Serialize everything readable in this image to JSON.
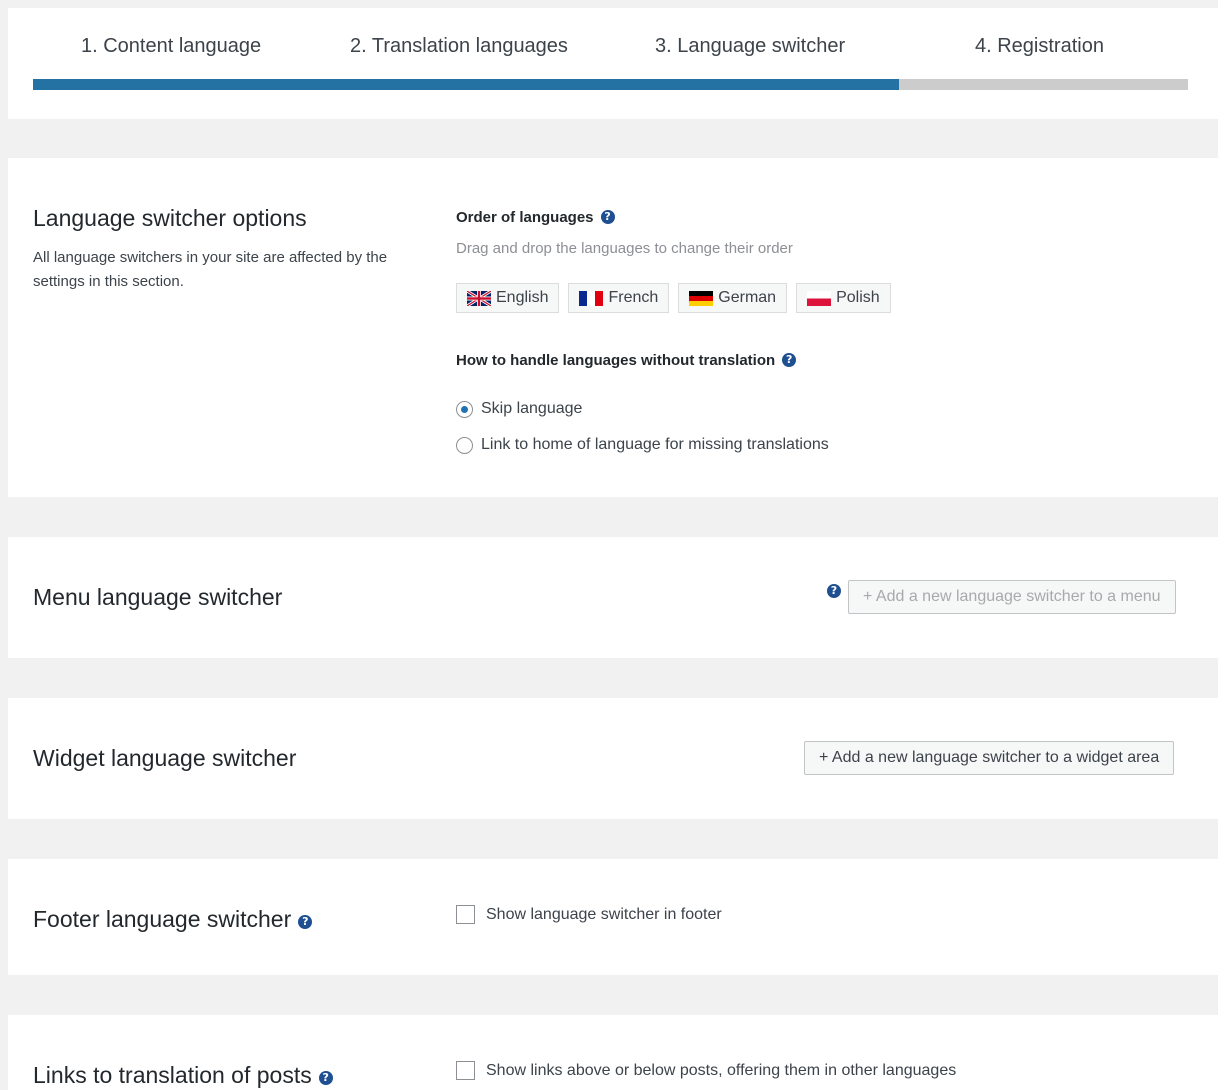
{
  "steps": [
    {
      "label": "1. Content language"
    },
    {
      "label": "2. Translation languages"
    },
    {
      "label": "3. Language switcher"
    },
    {
      "label": "4. Registration"
    }
  ],
  "progress": {
    "percent": 75,
    "fill_color": "#2471a3",
    "track_color": "#cccccc"
  },
  "options": {
    "title": "Language switcher options",
    "description": "All language switchers in your site are affected by the settings in this section.",
    "order_label": "Order of languages",
    "order_hint": "Drag and drop the languages to change their order",
    "languages": [
      {
        "name": "English",
        "flag": "uk-flag-icon"
      },
      {
        "name": "French",
        "flag": "france-flag-icon"
      },
      {
        "name": "German",
        "flag": "germany-flag-icon"
      },
      {
        "name": "Polish",
        "flag": "poland-flag-icon"
      }
    ],
    "missing_label": "How to handle languages without translation",
    "radio_options": [
      {
        "label": "Skip language",
        "checked": true
      },
      {
        "label": "Link to home of language for missing translations",
        "checked": false
      }
    ]
  },
  "menu": {
    "title": "Menu language switcher",
    "button_label": "+ Add a new language switcher to a menu"
  },
  "widget": {
    "title": "Widget language switcher",
    "button_label": "+ Add a new language switcher to a widget area"
  },
  "footer": {
    "title": "Footer language switcher",
    "checkbox_label": "Show language switcher in footer"
  },
  "links": {
    "title": "Links to translation of posts",
    "checkbox_label": "Show links above or below posts, offering them in other languages"
  },
  "icons": {
    "help": "question-mark-circle-icon"
  },
  "colors": {
    "help_icon": "#1d4f91",
    "radio_dot": "#2271b1",
    "background": "#f1f1f1"
  }
}
